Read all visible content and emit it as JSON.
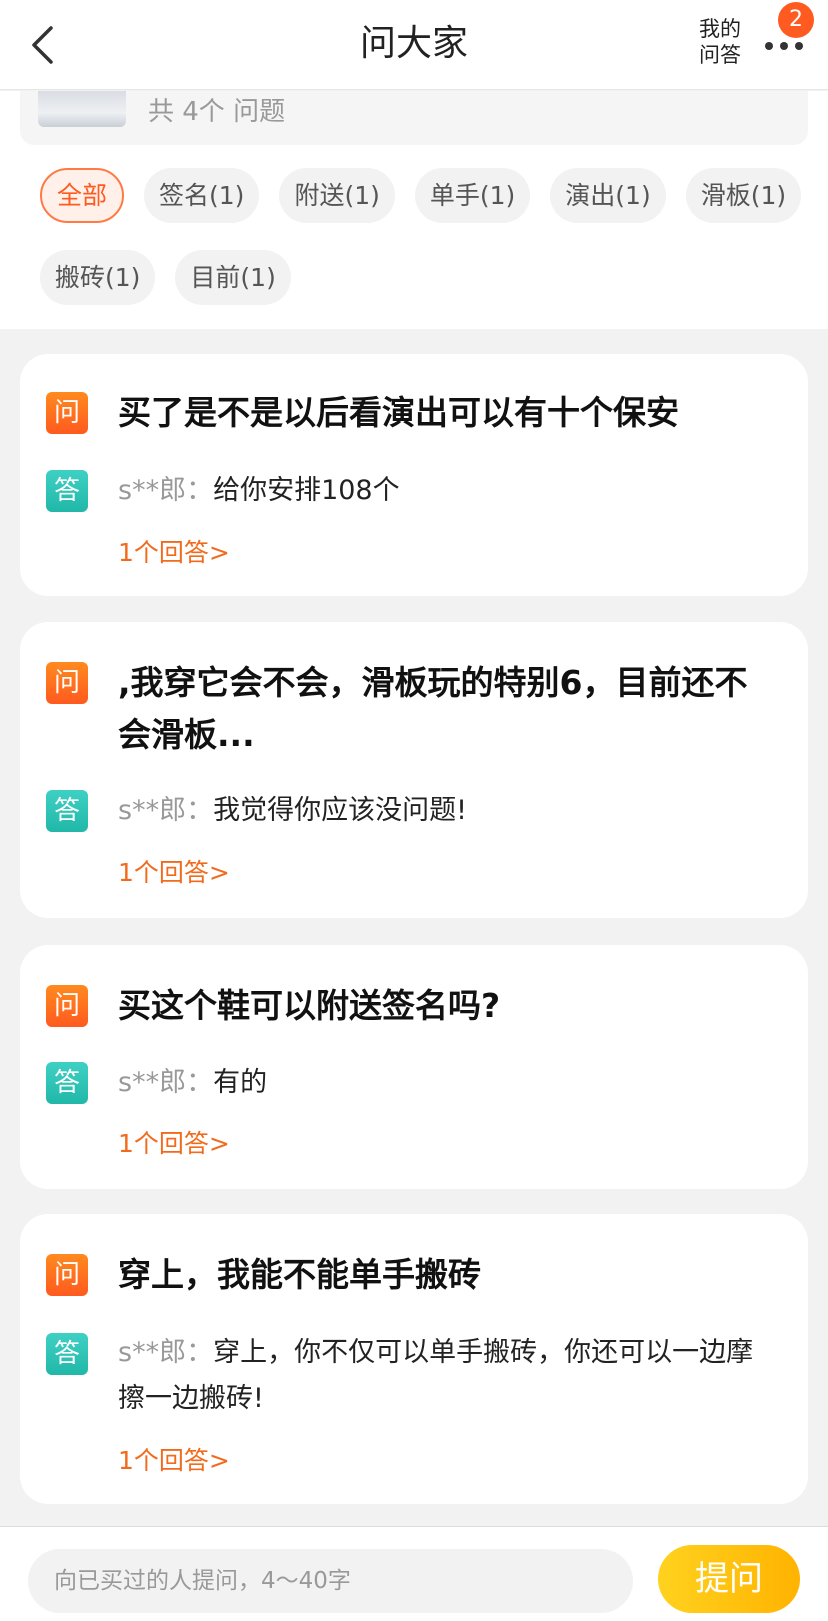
{
  "header": {
    "title": "问大家",
    "my_qa_line1": "我的",
    "my_qa_line2": "问答",
    "badge_count": "2",
    "back_icon": "chevron-left-icon",
    "more_icon": "more-horizontal-icon"
  },
  "summary": {
    "text": "共 4个 问题"
  },
  "tags": [
    {
      "label": "全部",
      "active": true
    },
    {
      "label": "签名(1)"
    },
    {
      "label": "附送(1)"
    },
    {
      "label": "单手(1)"
    },
    {
      "label": "演出(1)"
    },
    {
      "label": "滑板(1)"
    },
    {
      "label": "搬砖(1)"
    },
    {
      "label": "目前(1)"
    }
  ],
  "labels": {
    "q_icon": "问",
    "a_icon": "答"
  },
  "questions": [
    {
      "question": "买了是不是以后看演出可以有十个保安",
      "answer_user": "s**郎：",
      "answer_text": "给你安排108个",
      "answer_count": "1个回答>"
    },
    {
      "question": ",我穿它会不会，滑板玩的特别6，目前还不会滑板...",
      "answer_user": "s**郎：",
      "answer_text": "我觉得你应该没问题!",
      "answer_count": "1个回答>"
    },
    {
      "question": "买这个鞋可以附送签名吗?",
      "answer_user": "s**郎：",
      "answer_text": "有的",
      "answer_count": "1个回答>"
    },
    {
      "question": "穿上，我能不能单手搬砖",
      "answer_user": "s**郎：",
      "answer_text": "穿上，你不仅可以单手搬砖，你还可以一边摩擦一边搬砖!",
      "answer_count": "1个回答>"
    }
  ],
  "bottom": {
    "placeholder": "向已买过的人提问，4～40字",
    "ask_label": "提问"
  },
  "colors": {
    "accent": "#ff5a1f",
    "answer_green": "#21b8a8",
    "ask_button": "#ffc107"
  }
}
